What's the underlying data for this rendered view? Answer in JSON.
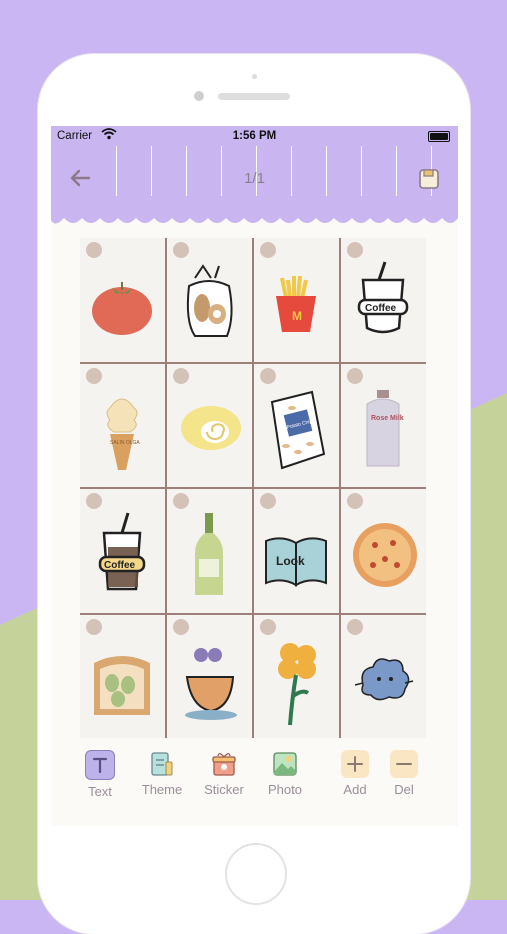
{
  "status_bar": {
    "carrier": "Carrier",
    "time": "1:56 PM"
  },
  "header": {
    "page_indicator": "1/1"
  },
  "grid": {
    "cells": [
      {
        "sticker": "tomato"
      },
      {
        "sticker": "bread-bag"
      },
      {
        "sticker": "fries"
      },
      {
        "sticker": "coffee-cup",
        "text": "Coffee"
      },
      {
        "sticker": "ice-cream-cone",
        "text": "SALIN OLGA"
      },
      {
        "sticker": "swiss-roll"
      },
      {
        "sticker": "snack-bag",
        "text": "Potato Chips"
      },
      {
        "sticker": "rose-milk-bottle",
        "text": "Rose Milk"
      },
      {
        "sticker": "iced-coffee",
        "text": "Coffee"
      },
      {
        "sticker": "wine-bottle"
      },
      {
        "sticker": "open-book",
        "text": "Look"
      },
      {
        "sticker": "pizza"
      },
      {
        "sticker": "avocado-toast"
      },
      {
        "sticker": "flower-pot"
      },
      {
        "sticker": "yellow-flower"
      },
      {
        "sticker": "blue-cloud"
      }
    ]
  },
  "toolbar": {
    "items": [
      {
        "label": "Text",
        "icon": "text-icon"
      },
      {
        "label": "Theme",
        "icon": "theme-icon"
      },
      {
        "label": "Sticker",
        "icon": "sticker-icon"
      },
      {
        "label": "Photo",
        "icon": "photo-icon"
      },
      {
        "label": "Add",
        "icon": "plus-icon"
      },
      {
        "label": "Del",
        "icon": "minus-icon"
      }
    ]
  },
  "colors": {
    "background_purple": "#cbb6f4",
    "background_green": "#c5d39a",
    "header_purple": "#c9b6f0",
    "grid_line": "#9c7f78"
  }
}
